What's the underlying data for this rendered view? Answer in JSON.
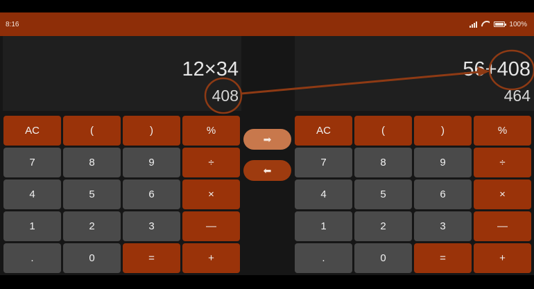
{
  "status": {
    "time": "8:16",
    "battery": "100%"
  },
  "left": {
    "expression": "12×34",
    "result": "408",
    "keys": [
      "AC",
      "(",
      ")",
      "%",
      "7",
      "8",
      "9",
      "÷",
      "4",
      "5",
      "6",
      "×",
      "1",
      "2",
      "3",
      "—",
      ".",
      "0",
      "=",
      "+"
    ]
  },
  "right": {
    "expression": "56+408",
    "result": "464",
    "keys": [
      "AC",
      "(",
      ")",
      "%",
      "7",
      "8",
      "9",
      "÷",
      "4",
      "5",
      "6",
      "×",
      "1",
      "2",
      "3",
      "—",
      ".",
      "0",
      "=",
      "+"
    ]
  },
  "transfer": {
    "forward": "➡",
    "back": "⬅"
  },
  "colors": {
    "accent": "#9a3309",
    "statusbar": "#8e2e08",
    "annotation": "#8e3a14"
  }
}
